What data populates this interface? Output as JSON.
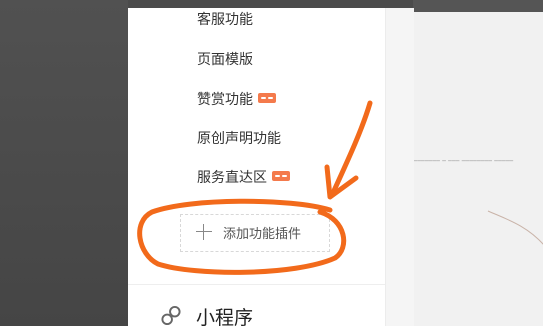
{
  "menu": {
    "items": [
      {
        "label": "客服功能",
        "badge": false
      },
      {
        "label": "页面模版",
        "badge": false
      },
      {
        "label": "赞赏功能",
        "badge": true
      },
      {
        "label": "原创声明功能",
        "badge": false
      },
      {
        "label": "服务直达区",
        "badge": true
      }
    ]
  },
  "add_plugin": {
    "label": "添加功能插件",
    "icon": "plus-icon"
  },
  "mini_program": {
    "label": "小程序",
    "icon": "link-icon"
  },
  "colors": {
    "badge": "#f47a4c",
    "annotation": "#f26a1b",
    "panel": "#ffffff",
    "backdrop": "#4b4b4b"
  }
}
